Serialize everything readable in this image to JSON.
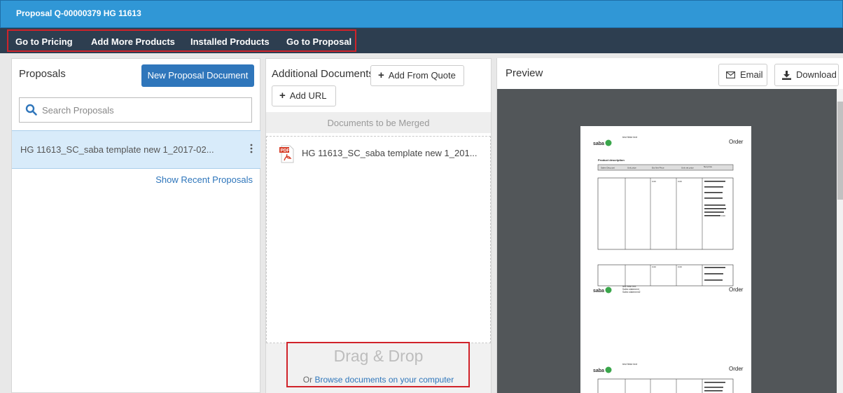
{
  "window": {
    "title": "Proposal Q-00000379 HG 11613"
  },
  "nav": {
    "items": [
      "Go to Pricing",
      "Add More Products",
      "Installed Products",
      "Go to Proposal"
    ]
  },
  "proposals": {
    "heading": "Proposals",
    "new_button": "New Proposal Document",
    "search_placeholder": "Search Proposals",
    "items": [
      {
        "label": "HG 11613_SC_saba template new 1_2017-02..."
      }
    ],
    "recent_link": "Show Recent Proposals"
  },
  "additional": {
    "heading": "Additional Documents",
    "add_from_quote": "Add From Quote",
    "add_url": "Add URL",
    "merge_label": "Documents to be Merged",
    "documents": [
      {
        "label": "HG 11613_SC_saba template new 1_201...",
        "type": "PDF"
      }
    ],
    "drop_title": "Drag & Drop",
    "drop_prefix": "Or",
    "drop_link": "Browse documents on your computer"
  },
  "preview": {
    "heading": "Preview",
    "email_button": "Email",
    "download_button": "Download",
    "page": {
      "logo": "saba",
      "order_label": "Order",
      "small_text": "test fieke text",
      "product_description": "Product description",
      "columns": [
        "Sales Discount",
        "Unit price",
        "Ext Net Price",
        "Unit net price",
        "Net price"
      ],
      "values": [
        "0.00",
        "0.00"
      ],
      "footer_lines": [
        "test fieke text",
        "Sales statement",
        "Sales statement2"
      ],
      "total_value": "0.00"
    }
  },
  "colors": {
    "titlebar": "#3097d6",
    "navbar": "#2d3e50",
    "primary": "#2f76bb",
    "highlight": "#d0232a",
    "preview_bg": "#525659",
    "selected_row": "#d8ebfa"
  },
  "icons": [
    "search-icon",
    "kebab-icon",
    "plus-icon",
    "pdf-file-icon",
    "envelope-icon",
    "download-icon"
  ]
}
